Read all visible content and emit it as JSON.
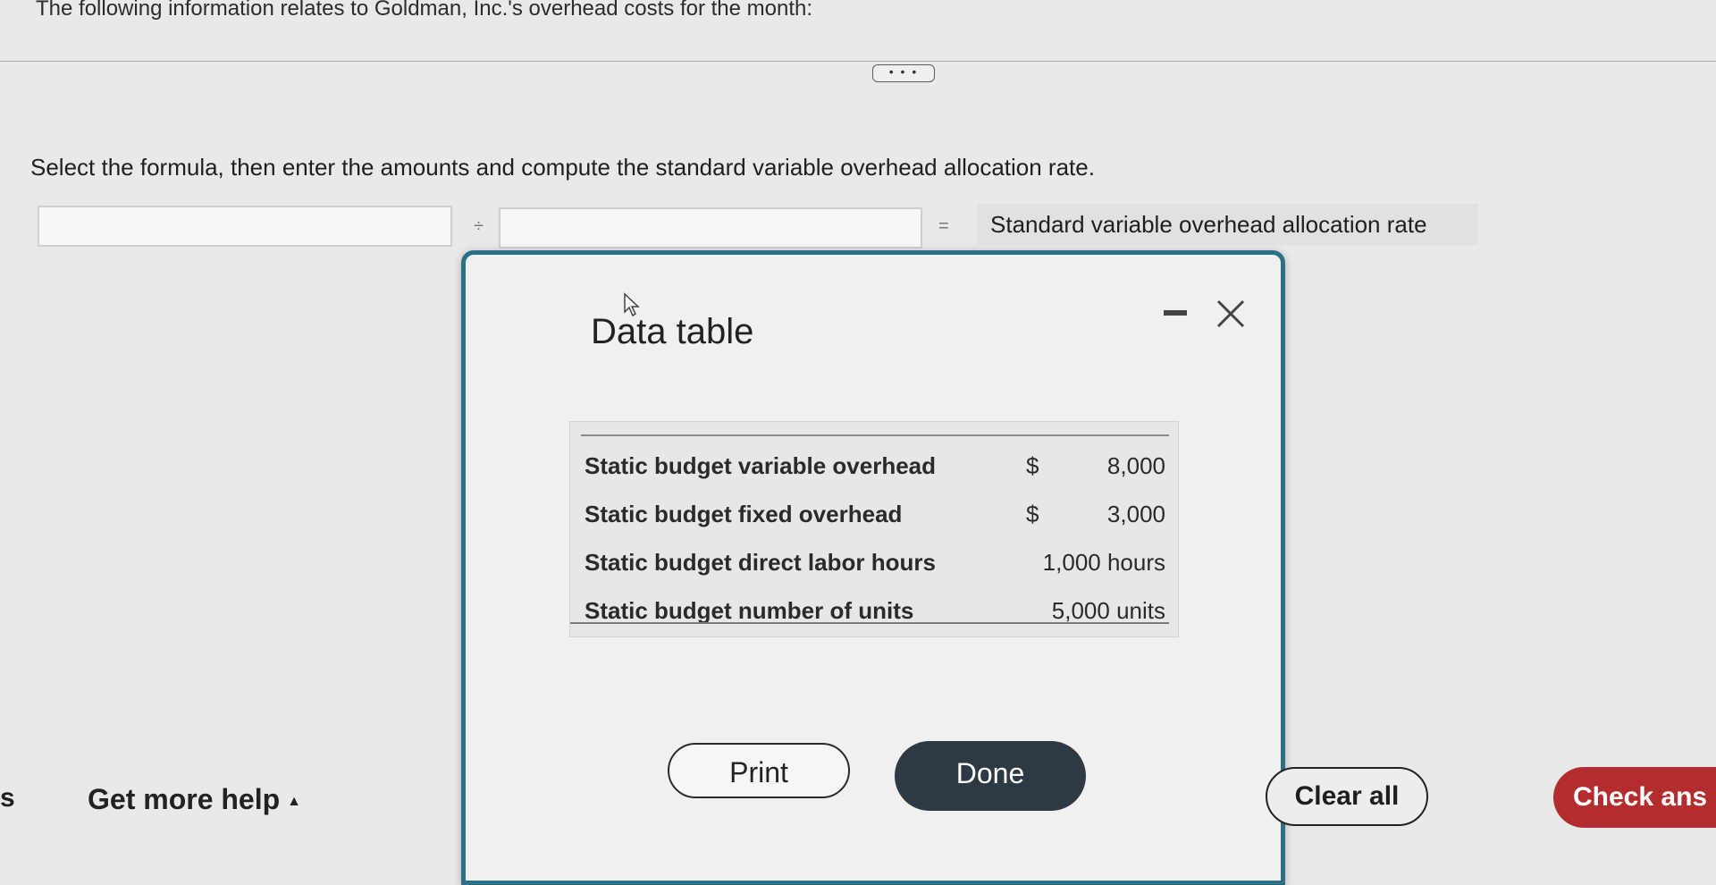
{
  "intro_text": "The following information relates to Goldman, Inc.'s overhead costs for the month:",
  "more_button": "• • •",
  "instruction": "Select the formula, then enter the amounts and compute the standard variable overhead allocation rate.",
  "formula": {
    "divide_symbol": "÷",
    "equals_symbol": "=",
    "result_label": "Standard variable overhead allocation rate"
  },
  "modal": {
    "title": "Data table",
    "rows": [
      {
        "label": "Static budget variable overhead",
        "currency": "$",
        "value": "8,000"
      },
      {
        "label": "Static budget fixed overhead",
        "currency": "$",
        "value": "3,000"
      },
      {
        "label": "Static budget direct labor hours",
        "currency": "",
        "value": "1,000 hours"
      },
      {
        "label": "Static budget number of units",
        "currency": "",
        "value": "5,000 units"
      }
    ],
    "print_label": "Print",
    "done_label": "Done"
  },
  "bottom_bar": {
    "edge_text": "s",
    "help_label": "Get more help",
    "clear_label": "Clear all",
    "check_label": "Check ans"
  },
  "colors": {
    "modal_border": "#2c6f86",
    "done_button": "#2d3a44",
    "check_button": "#b32c2e"
  }
}
